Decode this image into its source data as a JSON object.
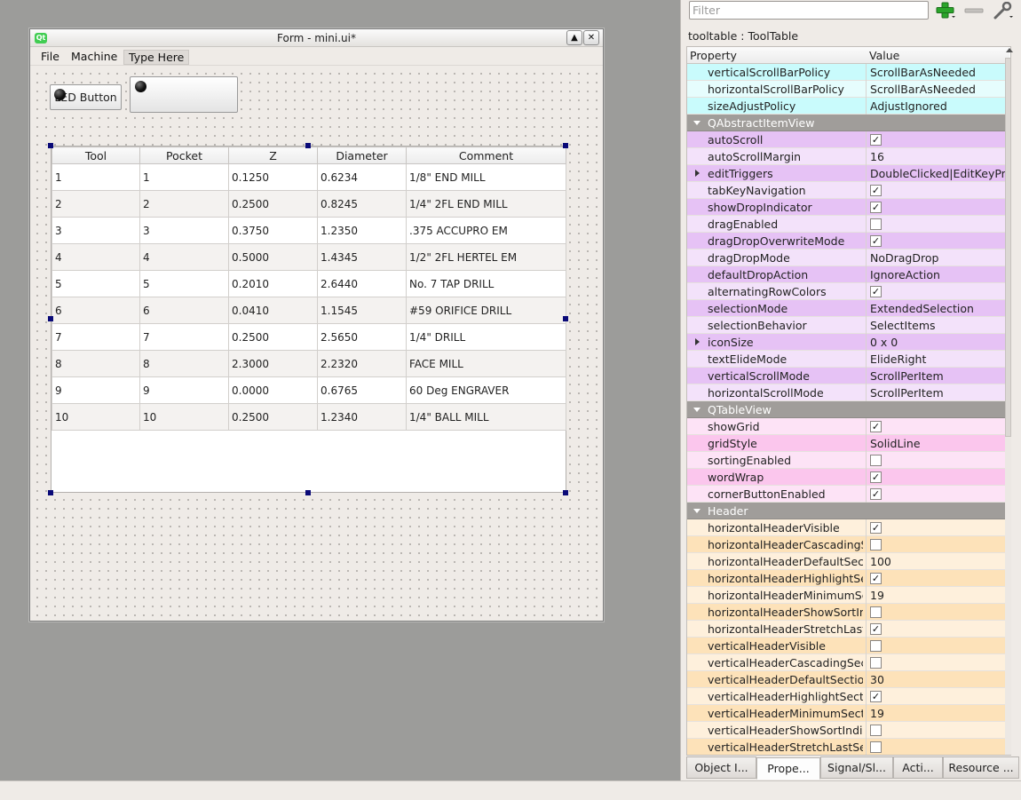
{
  "form_window": {
    "title": "Form - mini.ui*",
    "logo": "Qt",
    "shade_glyph": "▲",
    "close_glyph": "✕",
    "menu": [
      "File",
      "Machine",
      "Type Here"
    ],
    "led_button_label": "LED Button",
    "table": {
      "columns": [
        "Tool",
        "Pocket",
        "Z",
        "Diameter",
        "Comment"
      ],
      "rows": [
        [
          "1",
          "1",
          "0.1250",
          "0.6234",
          "1/8\" END MILL"
        ],
        [
          "2",
          "2",
          "0.2500",
          "0.8245",
          "1/4\" 2FL END MILL"
        ],
        [
          "3",
          "3",
          "0.3750",
          "1.2350",
          ".375 ACCUPRO EM"
        ],
        [
          "4",
          "4",
          "0.5000",
          "1.4345",
          "1/2\" 2FL HERTEL EM"
        ],
        [
          "5",
          "5",
          "0.2010",
          "2.6440",
          "No. 7 TAP DRILL"
        ],
        [
          "6",
          "6",
          "0.0410",
          "1.1545",
          "#59 ORIFICE DRILL"
        ],
        [
          "7",
          "7",
          "0.2500",
          "2.5650",
          "1/4\" DRILL"
        ],
        [
          "8",
          "8",
          "2.3000",
          "2.2320",
          "FACE MILL"
        ],
        [
          "9",
          "9",
          "0.0000",
          "0.6765",
          "60 Deg ENGRAVER"
        ],
        [
          "10",
          "10",
          "0.2500",
          "1.2340",
          "1/4\" BALL MILL"
        ]
      ]
    }
  },
  "property_editor": {
    "filter_placeholder": "Filter",
    "object_label": "tooltable : ToolTable",
    "headers": {
      "property": "Property",
      "value": "Value"
    },
    "icons": [
      "plus-icon",
      "minus-icon",
      "wrench-icon"
    ],
    "check_glyph": "✓",
    "rows": [
      {
        "name": "verticalScrollBarPolicy",
        "value": "ScrollBarAsNeeded",
        "color": "c-cyan-a"
      },
      {
        "name": "horizontalScrollBarPolicy",
        "value": "ScrollBarAsNeeded",
        "color": "c-cyan-b"
      },
      {
        "name": "sizeAdjustPolicy",
        "value": "AdjustIgnored",
        "color": "c-cyan-a"
      },
      {
        "section": "QAbstractItemView"
      },
      {
        "name": "autoScroll",
        "check": true,
        "color": "c-purp-a"
      },
      {
        "name": "autoScrollMargin",
        "value": "16",
        "color": "c-purp-b"
      },
      {
        "name": "editTriggers",
        "value": "DoubleClicked|EditKeyPre...",
        "color": "c-purp-a",
        "expandable": true
      },
      {
        "name": "tabKeyNavigation",
        "check": true,
        "color": "c-purp-b"
      },
      {
        "name": "showDropIndicator",
        "check": true,
        "color": "c-purp-a"
      },
      {
        "name": "dragEnabled",
        "check": false,
        "color": "c-purp-b"
      },
      {
        "name": "dragDropOverwriteMode",
        "check": true,
        "color": "c-purp-a"
      },
      {
        "name": "dragDropMode",
        "value": "NoDragDrop",
        "color": "c-purp-b"
      },
      {
        "name": "defaultDropAction",
        "value": "IgnoreAction",
        "color": "c-purp-a"
      },
      {
        "name": "alternatingRowColors",
        "check": true,
        "color": "c-purp-b"
      },
      {
        "name": "selectionMode",
        "value": "ExtendedSelection",
        "color": "c-purp-a"
      },
      {
        "name": "selectionBehavior",
        "value": "SelectItems",
        "color": "c-purp-b"
      },
      {
        "name": "iconSize",
        "value": "0 x 0",
        "color": "c-purp-a",
        "expandable": true
      },
      {
        "name": "textElideMode",
        "value": "ElideRight",
        "color": "c-purp-b"
      },
      {
        "name": "verticalScrollMode",
        "value": "ScrollPerItem",
        "color": "c-purp-a"
      },
      {
        "name": "horizontalScrollMode",
        "value": "ScrollPerItem",
        "color": "c-purp-b"
      },
      {
        "section": "QTableView"
      },
      {
        "name": "showGrid",
        "check": true,
        "color": "c-pink-b"
      },
      {
        "name": "gridStyle",
        "value": "SolidLine",
        "color": "c-pink-a"
      },
      {
        "name": "sortingEnabled",
        "check": false,
        "color": "c-pink-b"
      },
      {
        "name": "wordWrap",
        "check": true,
        "color": "c-pink-a"
      },
      {
        "name": "cornerButtonEnabled",
        "check": true,
        "color": "c-pink-b"
      },
      {
        "section": "Header"
      },
      {
        "name": "horizontalHeaderVisible",
        "check": true,
        "color": "c-peach-b"
      },
      {
        "name": "horizontalHeaderCascadingS...",
        "check": false,
        "color": "c-peach-a"
      },
      {
        "name": "horizontalHeaderDefaultSecti...",
        "value": "100",
        "color": "c-peach-b"
      },
      {
        "name": "horizontalHeaderHighlightSe...",
        "check": true,
        "color": "c-peach-a"
      },
      {
        "name": "horizontalHeaderMinimumSe...",
        "value": "19",
        "color": "c-peach-b"
      },
      {
        "name": "horizontalHeaderShowSortIn...",
        "check": false,
        "color": "c-peach-a"
      },
      {
        "name": "horizontalHeaderStretchLast...",
        "check": true,
        "color": "c-peach-b"
      },
      {
        "name": "verticalHeaderVisible",
        "check": false,
        "color": "c-peach-a"
      },
      {
        "name": "verticalHeaderCascadingSec...",
        "check": false,
        "color": "c-peach-b"
      },
      {
        "name": "verticalHeaderDefaultSection...",
        "value": "30",
        "color": "c-peach-a"
      },
      {
        "name": "verticalHeaderHighlightSecti...",
        "check": true,
        "color": "c-peach-b"
      },
      {
        "name": "verticalHeaderMinimumSecti...",
        "value": "19",
        "color": "c-peach-a"
      },
      {
        "name": "verticalHeaderShowSortIndic...",
        "check": false,
        "color": "c-peach-b"
      },
      {
        "name": "verticalHeaderStretchLastSe...",
        "check": false,
        "color": "c-peach-a"
      }
    ],
    "tabs": [
      "Object I...",
      "Prope...",
      "Signal/Sl...",
      "Acti...",
      "Resource ..."
    ],
    "active_tab": 1
  }
}
